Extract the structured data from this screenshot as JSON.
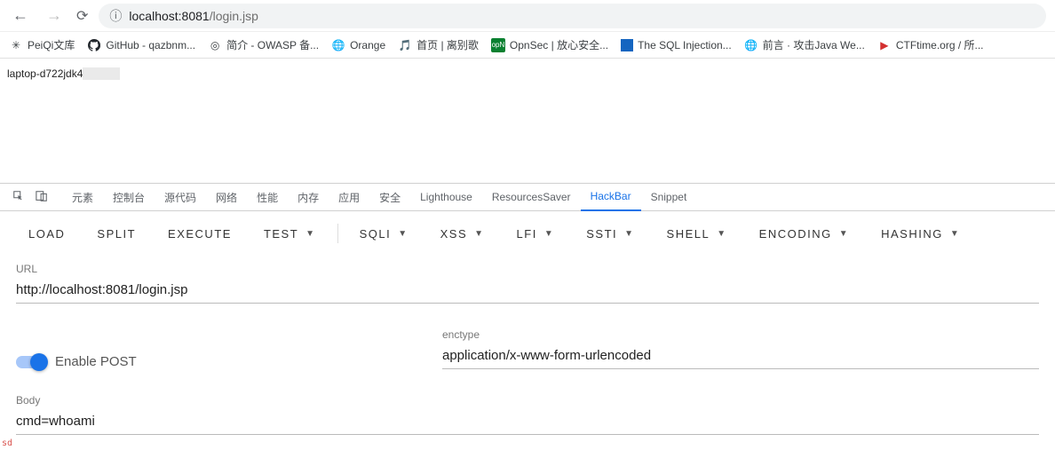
{
  "browser": {
    "url_host": "localhost:8081",
    "url_path": "/login.jsp"
  },
  "bookmarks": [
    {
      "label": "PeiQi文库",
      "icon": "✳"
    },
    {
      "label": "GitHub - qazbnm...",
      "icon": "gh"
    },
    {
      "label": "简介 - OWASP 备...",
      "icon": "◎"
    },
    {
      "label": "Orange",
      "icon": "globe"
    },
    {
      "label": "首页 | 离别歌",
      "icon": "note"
    },
    {
      "label": "OpnSec | 放心安全...",
      "icon": "opn"
    },
    {
      "label": "The SQL Injection...",
      "icon": "sql"
    },
    {
      "label": "前言 · 攻击Java We...",
      "icon": "globe"
    },
    {
      "label": "CTFtime.org / 所...",
      "icon": "ctf"
    }
  ],
  "page": {
    "response_prefix": "laptop-d722jdk4"
  },
  "devtools": {
    "tabs": [
      "元素",
      "控制台",
      "源代码",
      "网络",
      "性能",
      "内存",
      "应用",
      "安全",
      "Lighthouse",
      "ResourcesSaver",
      "HackBar",
      "Snippet"
    ],
    "active": "HackBar"
  },
  "hackbar": {
    "buttons": [
      "LOAD",
      "SPLIT",
      "EXECUTE"
    ],
    "menus": [
      "TEST",
      "SQLI",
      "XSS",
      "LFI",
      "SSTI",
      "SHELL",
      "ENCODING",
      "HASHING"
    ],
    "url_label": "URL",
    "url_value": "http://localhost:8081/login.jsp",
    "enable_post": "Enable POST",
    "enctype_label": "enctype",
    "enctype_value": "application/x-www-form-urlencoded",
    "body_label": "Body",
    "body_value": "cmd=whoami"
  },
  "footer": "sd",
  "watermark": ""
}
